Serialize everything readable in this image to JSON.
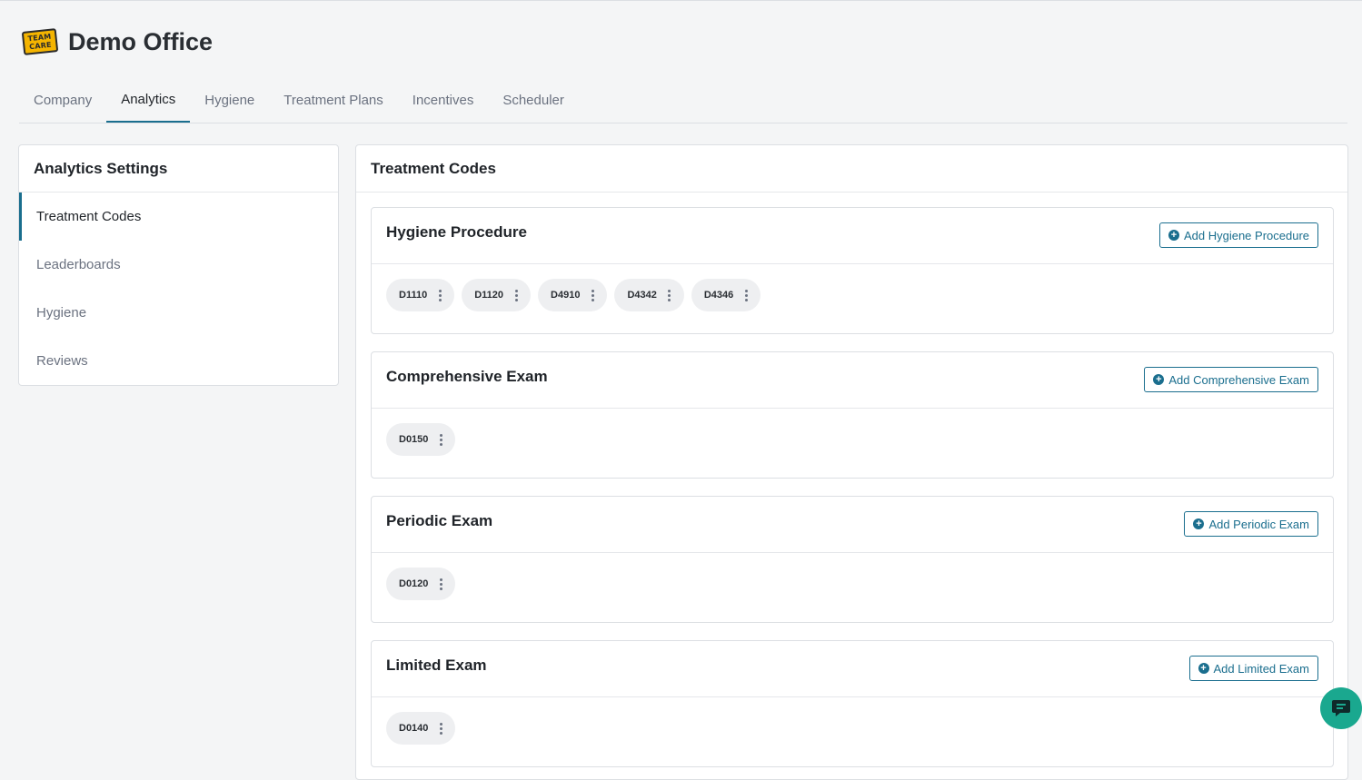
{
  "header": {
    "logo_text_top": "TEAM",
    "logo_text_bottom": "CARE",
    "office_title": "Demo Office"
  },
  "tabs": [
    {
      "label": "Company",
      "active": false
    },
    {
      "label": "Analytics",
      "active": true
    },
    {
      "label": "Hygiene",
      "active": false
    },
    {
      "label": "Treatment Plans",
      "active": false
    },
    {
      "label": "Incentives",
      "active": false
    },
    {
      "label": "Scheduler",
      "active": false
    }
  ],
  "settings": {
    "title": "Analytics Settings",
    "items": [
      {
        "label": "Treatment Codes",
        "active": true
      },
      {
        "label": "Leaderboards",
        "active": false
      },
      {
        "label": "Hygiene",
        "active": false
      },
      {
        "label": "Reviews",
        "active": false
      }
    ]
  },
  "main": {
    "title": "Treatment Codes",
    "sections": [
      {
        "title": "Hygiene Procedure",
        "add_label": "Add Hygiene Procedure",
        "codes": [
          "D1110",
          "D1120",
          "D4910",
          "D4342",
          "D4346"
        ]
      },
      {
        "title": "Comprehensive Exam",
        "add_label": "Add Comprehensive Exam",
        "codes": [
          "D0150"
        ]
      },
      {
        "title": "Periodic Exam",
        "add_label": "Add Periodic Exam",
        "codes": [
          "D0120"
        ]
      },
      {
        "title": "Limited Exam",
        "add_label": "Add Limited Exam",
        "codes": [
          "D0140"
        ]
      }
    ]
  },
  "colors": {
    "accent": "#1a6e8e",
    "chat": "#1aa88f",
    "logo": "#f4b400"
  },
  "icons": {
    "add": "plus-circle-icon",
    "chip_menu": "kebab-icon",
    "chat": "chat-bubble-icon"
  }
}
